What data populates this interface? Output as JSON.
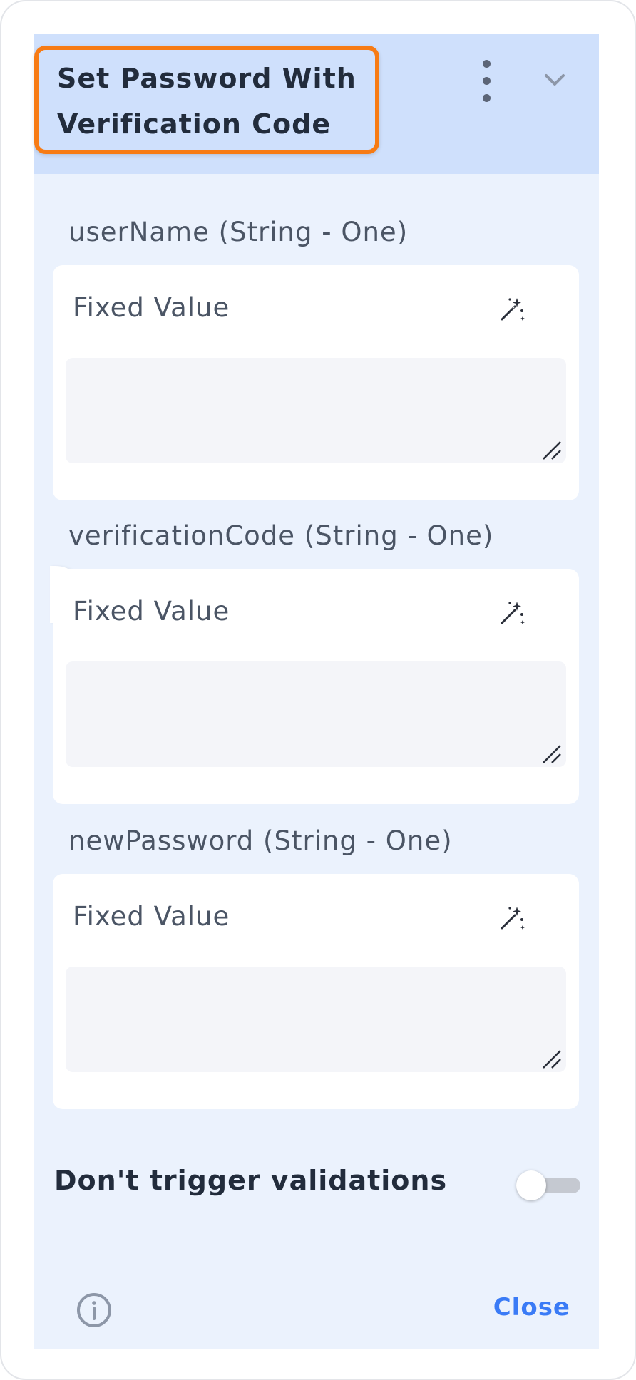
{
  "header": {
    "title": "Set Password With Verification Code",
    "title_line1": "Set Password With",
    "title_line2": "Verification Code",
    "menu_icon": "kebab-vertical-icon",
    "collapse_icon": "chevron-down-icon"
  },
  "fields": [
    {
      "label": "userName (String - One)",
      "mode": "Fixed Value",
      "value": ""
    },
    {
      "label": "verificationCode (String - One)",
      "mode": "Fixed Value",
      "value": ""
    },
    {
      "label": "newPassword (String - One)",
      "mode": "Fixed Value",
      "value": ""
    }
  ],
  "options": {
    "dont_trigger_validations_label": "Don't trigger validations",
    "dont_trigger_validations": false
  },
  "footer": {
    "info_icon": "info-circle-icon",
    "close_label": "Close"
  },
  "colors": {
    "header_bg": "#cfe0fc",
    "panel_bg": "#ebf2fd",
    "highlight": "#f77b14",
    "accent": "#3a7bf6"
  }
}
